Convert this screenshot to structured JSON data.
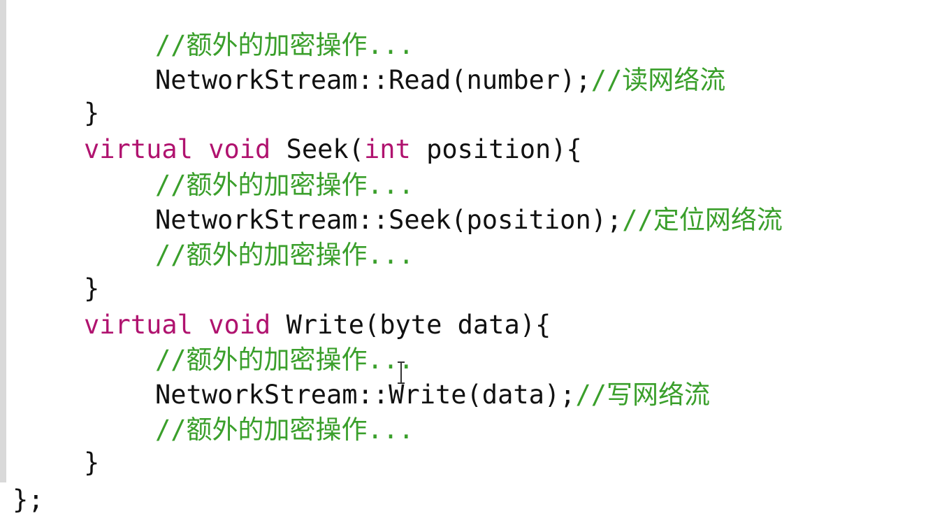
{
  "code_lines": [
    {
      "segments": [
        {
          "t": "//额外的加密操作...",
          "c": "cm"
        }
      ]
    },
    {
      "segments": [
        {
          "t": "NetworkStream::Read(number);",
          "c": "pl"
        },
        {
          "t": "//读网络流",
          "c": "cm"
        }
      ]
    },
    {
      "segments": [
        {
          "t": "}",
          "c": "pl"
        }
      ]
    },
    {
      "segments": [
        {
          "t": "virtual void",
          "c": "kw"
        },
        {
          "t": " Seek(",
          "c": "pl"
        },
        {
          "t": "int",
          "c": "kw"
        },
        {
          "t": " position){",
          "c": "pl"
        }
      ]
    },
    {
      "segments": [
        {
          "t": "//额外的加密操作...",
          "c": "cm"
        }
      ]
    },
    {
      "segments": [
        {
          "t": "NetworkStream::Seek(position);",
          "c": "pl"
        },
        {
          "t": "//定位网络流",
          "c": "cm"
        }
      ]
    },
    {
      "segments": [
        {
          "t": "//额外的加密操作...",
          "c": "cm"
        }
      ]
    },
    {
      "segments": [
        {
          "t": "}",
          "c": "pl"
        }
      ]
    },
    {
      "segments": [
        {
          "t": "virtual void",
          "c": "kw"
        },
        {
          "t": " Write(byte data){",
          "c": "pl"
        }
      ]
    },
    {
      "segments": [
        {
          "t": "//额外的加密操作...",
          "c": "cm"
        }
      ]
    },
    {
      "segments": [
        {
          "t": "NetworkStream::Write(data);",
          "c": "pl"
        },
        {
          "t": "//写网络流",
          "c": "cm"
        }
      ]
    },
    {
      "segments": [
        {
          "t": "//额外的加密操作...",
          "c": "cm"
        }
      ]
    },
    {
      "segments": [
        {
          "t": "}",
          "c": "pl"
        }
      ]
    },
    {
      "segments": [
        {
          "t": "};",
          "c": "pl"
        }
      ]
    }
  ],
  "colors": {
    "keyword": "#b0136f",
    "comment": "#3a9f2b",
    "plain": "#111111",
    "background": "#ffffff"
  }
}
